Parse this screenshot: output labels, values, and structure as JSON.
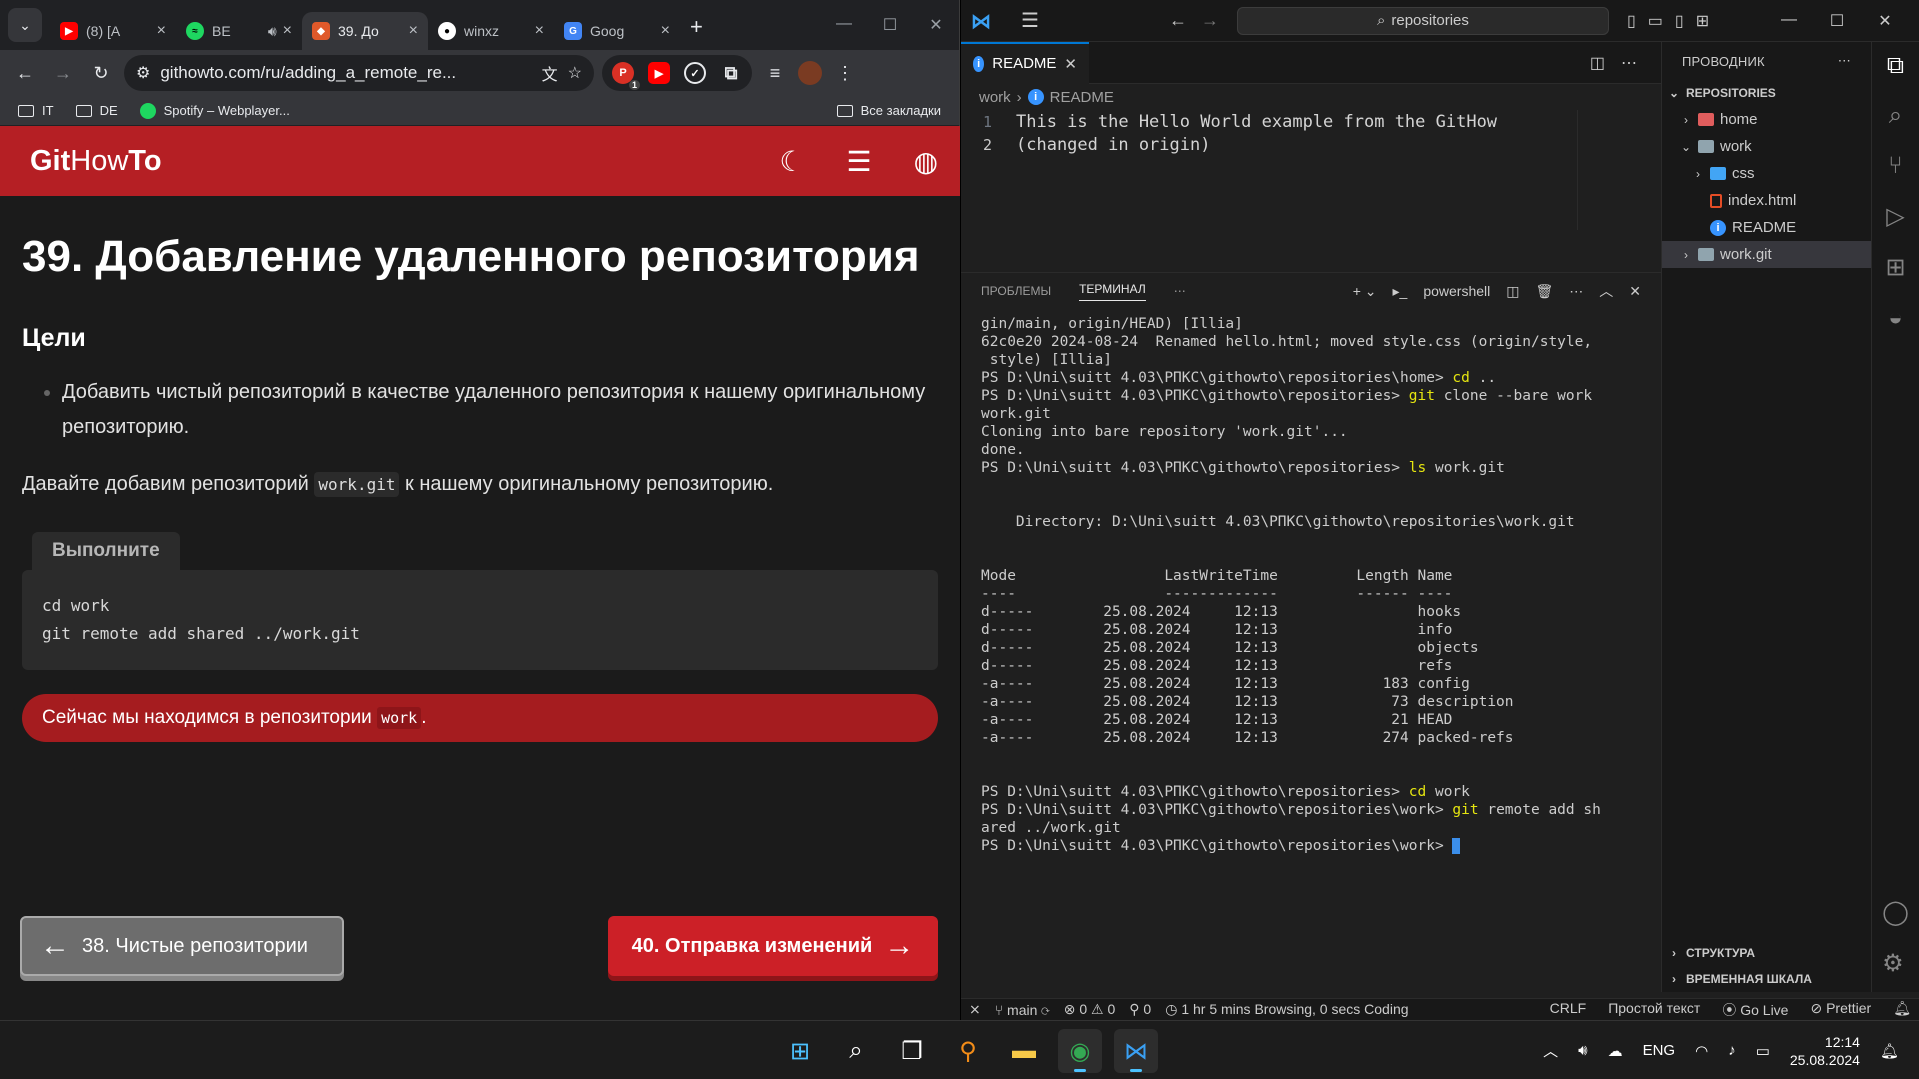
{
  "chrome": {
    "tabs": [
      {
        "label": "(8) [A",
        "color": "#ff0000",
        "icon": "youtube-icon"
      },
      {
        "label": "BE",
        "color": "#1ed760",
        "icon": "spotify-icon"
      },
      {
        "label": "39. До",
        "color": "#e0592a",
        "icon": "githowto-icon"
      },
      {
        "label": "winxz",
        "color": "#ffffff",
        "icon": "github-icon"
      },
      {
        "label": "Goog",
        "color": "#4285f4",
        "icon": "google-translate-icon"
      }
    ],
    "url": "githowto.com/ru/adding_a_remote_re...",
    "bookmarks": [
      "IT",
      "DE",
      "Spotify – Webplayer..."
    ],
    "all_bookmarks": "Все закладки",
    "ext_badge": "1"
  },
  "site": {
    "logo_bold": "Git",
    "logo_mid": "How",
    "logo_end": "To",
    "title": "39. Добавление удаленного репозитория",
    "goals_heading": "Цели",
    "goal_1": "Добавить чистый репозиторий в качестве удаленного репозитория к нашему оригинальному репозиторию.",
    "intro_a": "Давайте добавим репозиторий",
    "intro_code": "work.git",
    "intro_b": "к нашему оригинальному репозиторию.",
    "run_label": "Выполните",
    "code_l1": "cd work",
    "code_l2": "git remote add shared ../work.git",
    "notice_a": "Сейчас мы находимся в репозитории",
    "notice_code": "work",
    "notice_b": ".",
    "prev_label": "38. Чистые репозитории",
    "next_label": "40. Отправка изменений",
    "accent": "#b51f24"
  },
  "vscode": {
    "search": "repositories",
    "tab_label": "README",
    "breadcrumb_folder": "work",
    "breadcrumb_file": "README",
    "line1_num": "1",
    "line2_num": "2",
    "line1": "This is the Hello World example from the GitHow",
    "line2": "(changed in origin)",
    "panel_problems": "ПРОБЛЕМЫ",
    "panel_terminal": "ТЕРМИНАЛ",
    "shell": "powershell",
    "explorer_title": "ПРОВОДНИК",
    "root": "REPOSITORIES",
    "tree": {
      "home": "home",
      "work": "work",
      "css": "css",
      "index": "index.html",
      "readme": "README",
      "workgit": "work.git"
    },
    "outline": "СТРУКТУРА",
    "timeline": "ВРЕМЕННАЯ ШКАЛА",
    "status": {
      "branch": "main",
      "errors": "0",
      "warnings": "0",
      "ports": "0",
      "wakatime": "1 hr 5 mins Browsing, 0 secs Coding",
      "eol": "CRLF",
      "lang": "Простой текст",
      "golive": "Go Live",
      "prettier": "Prettier"
    }
  },
  "terminal": [
    "gin/main, origin/HEAD) [Illia]",
    "62c0e20 2024-08-24 | Renamed hello.html; moved style.css (origin/style,",
    " style) [Illia]",
    "PS D:\\Uni\\suitt 4.03\\РПКС\\githowto\\repositories\\home> |cd ..",
    "PS D:\\Uni\\suitt 4.03\\РПКС\\githowto\\repositories> |git clone --bare work",
    "work.git",
    "Cloning into bare repository 'work.git'...",
    "done.",
    "PS D:\\Uni\\suitt 4.03\\РПКС\\githowto\\repositories> |ls work.git",
    "",
    "",
    "    Directory: D:\\Uni\\suitt 4.03\\РПКС\\githowto\\repositories\\work.git",
    "",
    "",
    "Mode                 LastWriteTime         Length Name",
    "----                 -------------         ------ ----",
    "d-----        25.08.2024     12:13                hooks",
    "d-----        25.08.2024     12:13                info",
    "d-----        25.08.2024     12:13                objects",
    "d-----        25.08.2024     12:13                refs",
    "-a----        25.08.2024     12:13            183 config",
    "-a----        25.08.2024     12:13             73 description",
    "-a----        25.08.2024     12:13             21 HEAD",
    "-a----        25.08.2024     12:13            274 packed-refs",
    "",
    "",
    "PS D:\\Uni\\suitt 4.03\\РПКС\\githowto\\repositories> |cd work",
    "PS D:\\Uni\\suitt 4.03\\РПКС\\githowto\\repositories\\work> |git remote add sh",
    "ared ../work.git",
    "PS D:\\Uni\\suitt 4.03\\РПКС\\githowto\\repositories\\work> "
  ],
  "taskbar": {
    "lang": "ENG",
    "time": "12:14",
    "date": "25.08.2024"
  }
}
